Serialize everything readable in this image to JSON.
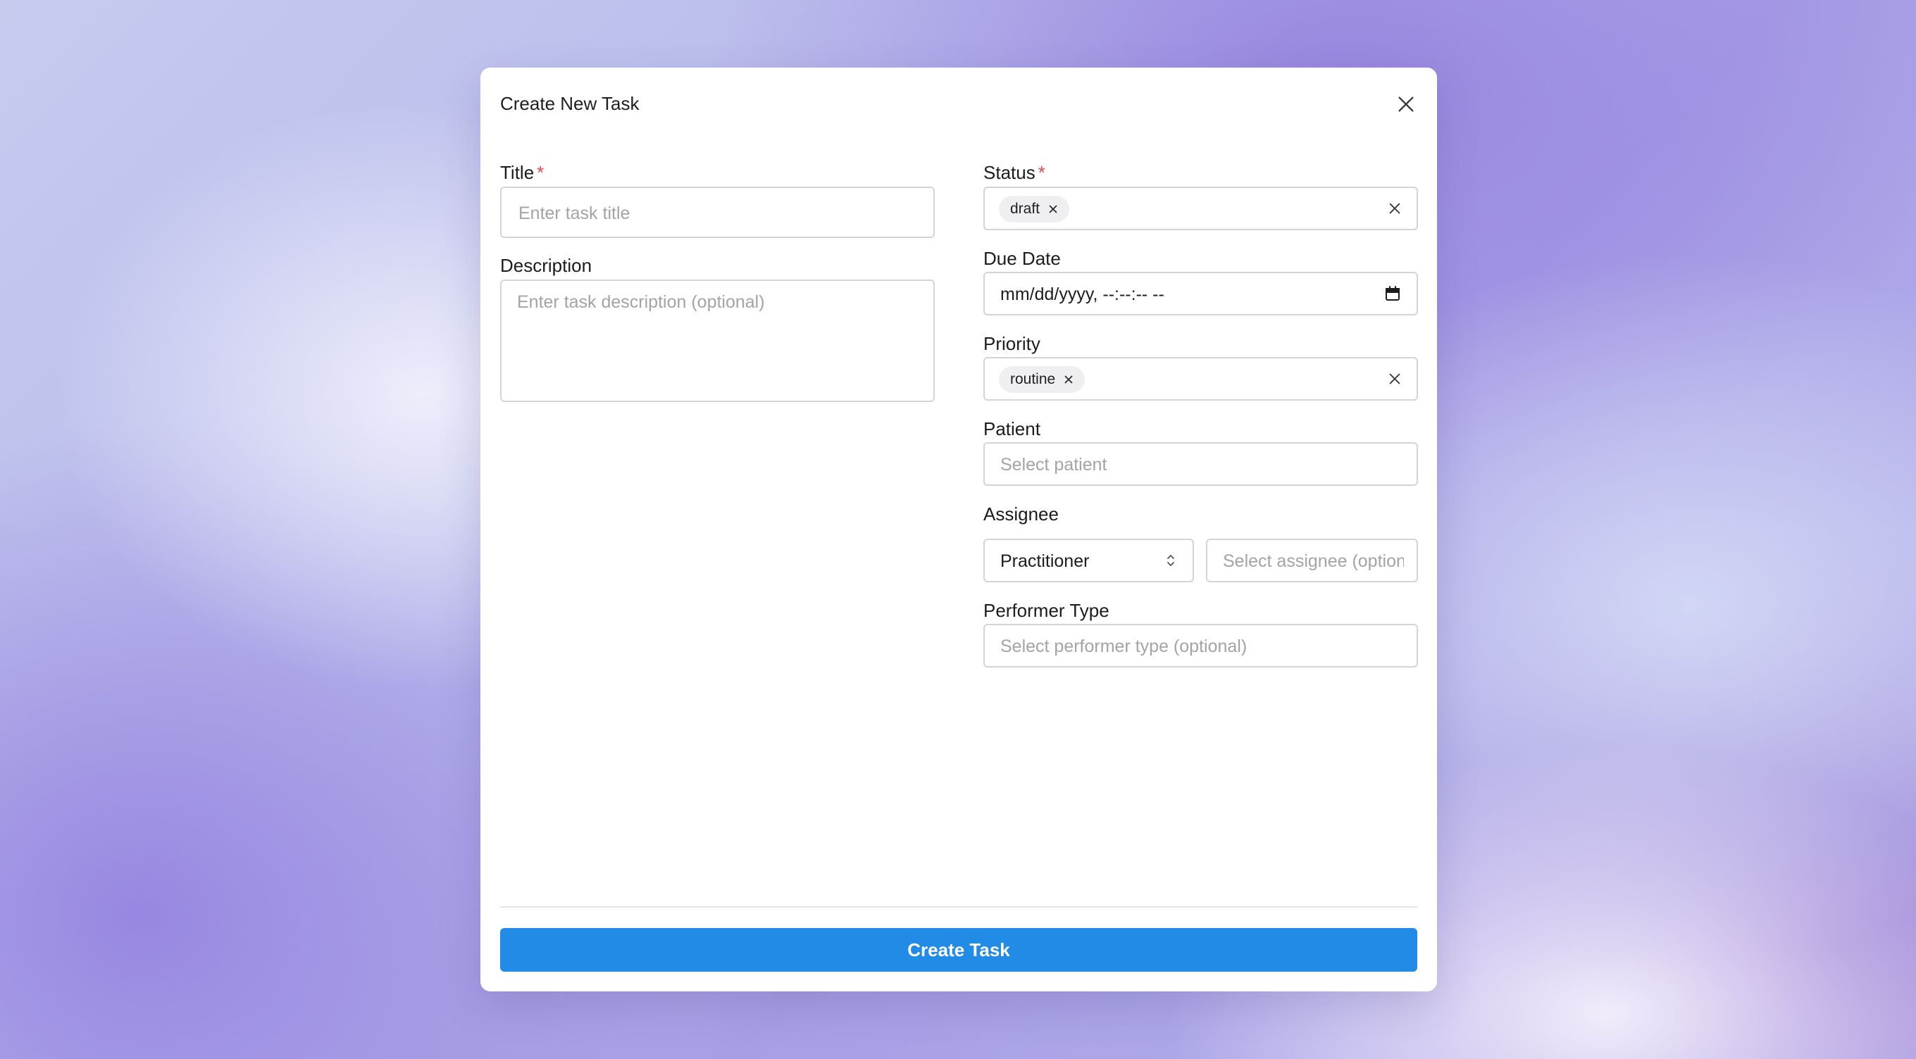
{
  "dialog": {
    "title": "Create New Task",
    "close_icon": "close-icon"
  },
  "form": {
    "title": {
      "label": "Title",
      "required_mark": "*",
      "placeholder": "Enter task title"
    },
    "description": {
      "label": "Description",
      "placeholder": "Enter task description (optional)"
    },
    "status": {
      "label": "Status",
      "required_mark": "*",
      "selected": "draft"
    },
    "due_date": {
      "label": "Due Date",
      "value": "mm/dd/yyyy, --:--:-- --",
      "icon": "calendar-icon"
    },
    "priority": {
      "label": "Priority",
      "selected": "routine"
    },
    "patient": {
      "label": "Patient",
      "placeholder": "Select patient"
    },
    "assignee": {
      "label": "Assignee",
      "type_value": "Practitioner",
      "placeholder": "Select assignee (optional)"
    },
    "performer_type": {
      "label": "Performer Type",
      "placeholder": "Select performer type (optional)"
    }
  },
  "footer": {
    "submit_label": "Create Task"
  },
  "colors": {
    "primary": "#228be6",
    "required": "#e5484d",
    "border": "#d4d4d8",
    "placeholder": "#a3a3a8"
  }
}
